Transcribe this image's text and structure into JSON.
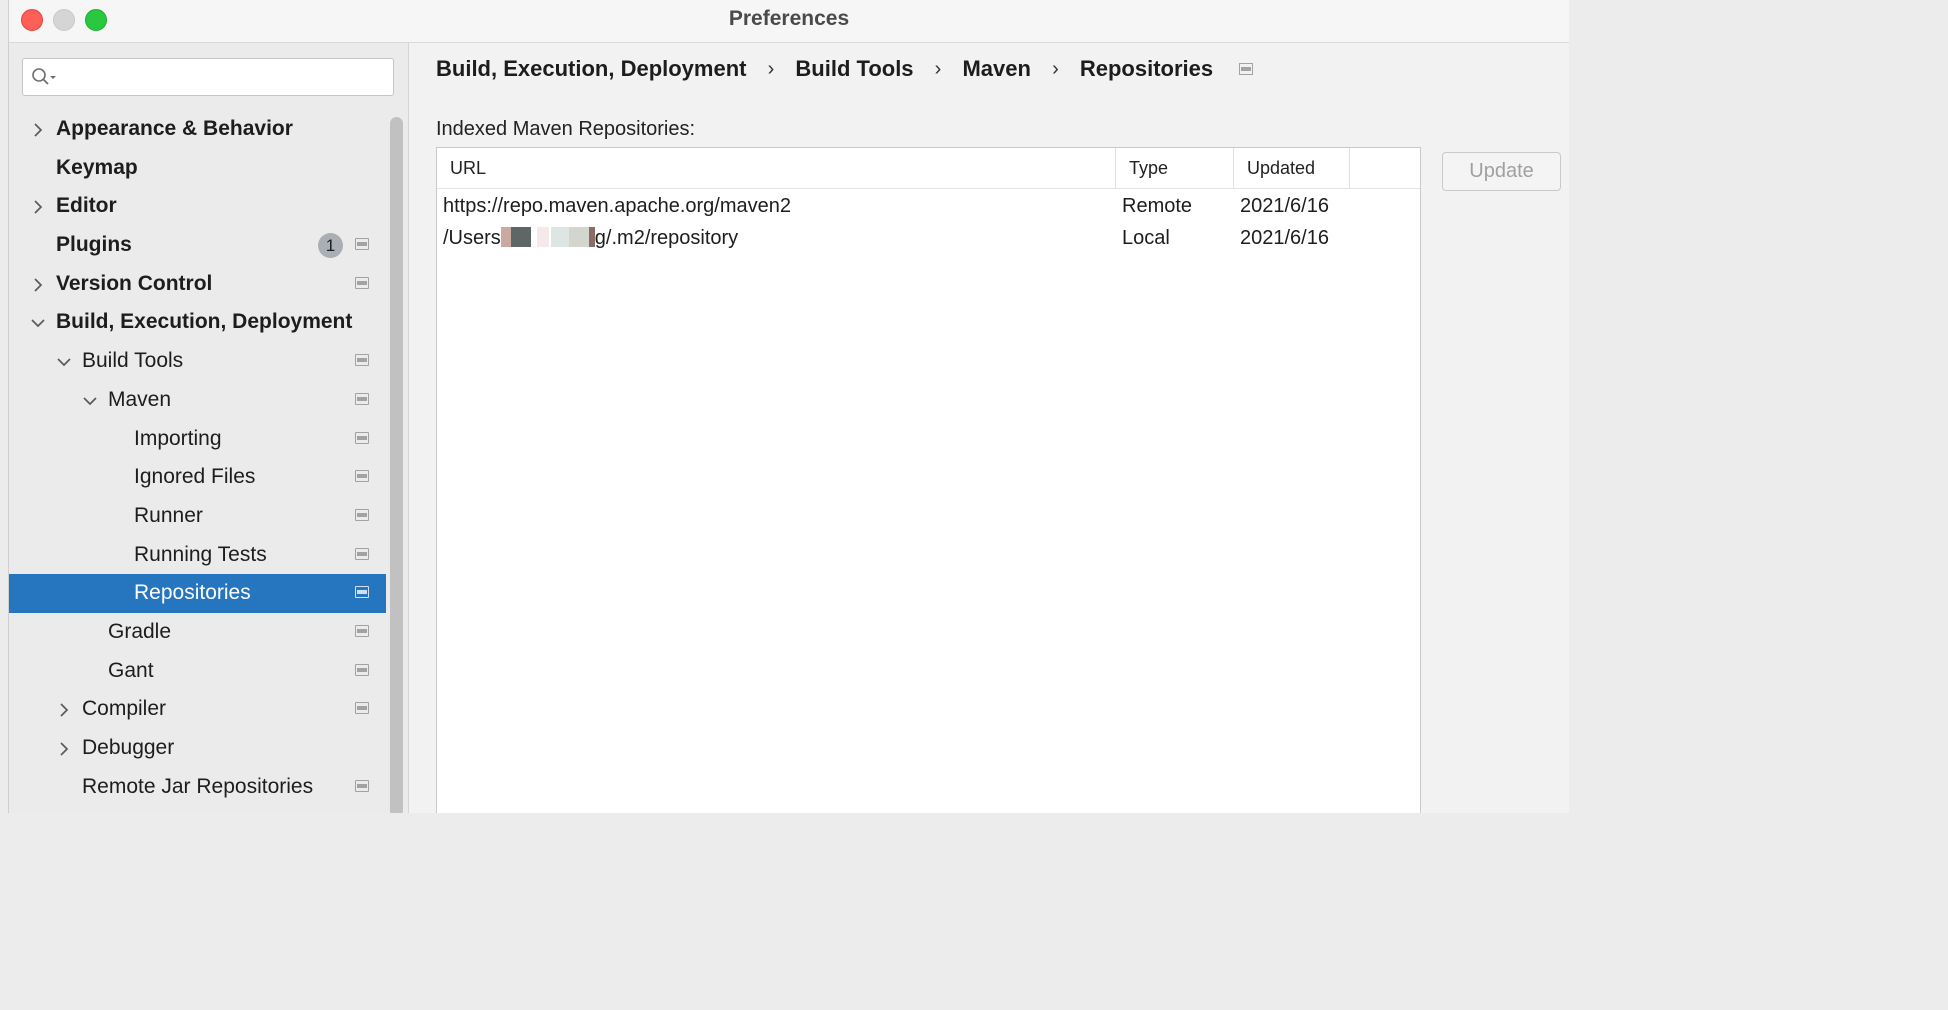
{
  "window": {
    "title": "Preferences"
  },
  "search": {
    "placeholder": ""
  },
  "tree": [
    {
      "label": "Appearance & Behavior",
      "bold": true,
      "indent": 0,
      "chevron": "right",
      "settings_icon": false,
      "badge": null,
      "selected": false
    },
    {
      "label": "Keymap",
      "bold": true,
      "indent": 0,
      "chevron": null,
      "settings_icon": false,
      "badge": null,
      "selected": false
    },
    {
      "label": "Editor",
      "bold": true,
      "indent": 0,
      "chevron": "right",
      "settings_icon": false,
      "badge": null,
      "selected": false
    },
    {
      "label": "Plugins",
      "bold": true,
      "indent": 0,
      "chevron": null,
      "settings_icon": true,
      "badge": "1",
      "selected": false
    },
    {
      "label": "Version Control",
      "bold": true,
      "indent": 0,
      "chevron": "right",
      "settings_icon": true,
      "badge": null,
      "selected": false
    },
    {
      "label": "Build, Execution, Deployment",
      "bold": true,
      "indent": 0,
      "chevron": "down",
      "settings_icon": false,
      "badge": null,
      "selected": false
    },
    {
      "label": "Build Tools",
      "bold": false,
      "indent": 1,
      "chevron": "down",
      "settings_icon": true,
      "badge": null,
      "selected": false
    },
    {
      "label": "Maven",
      "bold": false,
      "indent": 2,
      "chevron": "down",
      "settings_icon": true,
      "badge": null,
      "selected": false
    },
    {
      "label": "Importing",
      "bold": false,
      "indent": 3,
      "chevron": null,
      "settings_icon": true,
      "badge": null,
      "selected": false
    },
    {
      "label": "Ignored Files",
      "bold": false,
      "indent": 3,
      "chevron": null,
      "settings_icon": true,
      "badge": null,
      "selected": false
    },
    {
      "label": "Runner",
      "bold": false,
      "indent": 3,
      "chevron": null,
      "settings_icon": true,
      "badge": null,
      "selected": false
    },
    {
      "label": "Running Tests",
      "bold": false,
      "indent": 3,
      "chevron": null,
      "settings_icon": true,
      "badge": null,
      "selected": false
    },
    {
      "label": "Repositories",
      "bold": false,
      "indent": 3,
      "chevron": null,
      "settings_icon": true,
      "badge": null,
      "selected": true
    },
    {
      "label": "Gradle",
      "bold": false,
      "indent": 2,
      "chevron": null,
      "settings_icon": true,
      "badge": null,
      "selected": false
    },
    {
      "label": "Gant",
      "bold": false,
      "indent": 2,
      "chevron": null,
      "settings_icon": true,
      "badge": null,
      "selected": false
    },
    {
      "label": "Compiler",
      "bold": false,
      "indent": 1,
      "chevron": "right",
      "settings_icon": true,
      "badge": null,
      "selected": false
    },
    {
      "label": "Debugger",
      "bold": false,
      "indent": 1,
      "chevron": "right",
      "settings_icon": false,
      "badge": null,
      "selected": false
    },
    {
      "label": "Remote Jar Repositories",
      "bold": false,
      "indent": 1,
      "chevron": null,
      "settings_icon": true,
      "badge": null,
      "selected": false
    }
  ],
  "breadcrumb": {
    "items": [
      "Build, Execution, Deployment",
      "Build Tools",
      "Maven",
      "Repositories"
    ],
    "separator": "›"
  },
  "repositories": {
    "section_label": "Indexed Maven Repositories:",
    "columns": {
      "url": "URL",
      "type": "Type",
      "updated": "Updated"
    },
    "rows": [
      {
        "url_prefix": "https://repo.maven.apache.org/maven2",
        "url_suffix": "",
        "redacted": false,
        "type": "Remote",
        "updated": "2021/6/16"
      },
      {
        "url_prefix": "/Users",
        "url_suffix": "g/.m2/repository",
        "redacted": true,
        "type": "Local",
        "updated": "2021/6/16"
      }
    ],
    "update_button": "Update"
  },
  "colors": {
    "selection": "#2675bf",
    "close": "#fe5f57",
    "maximize": "#29c840"
  }
}
